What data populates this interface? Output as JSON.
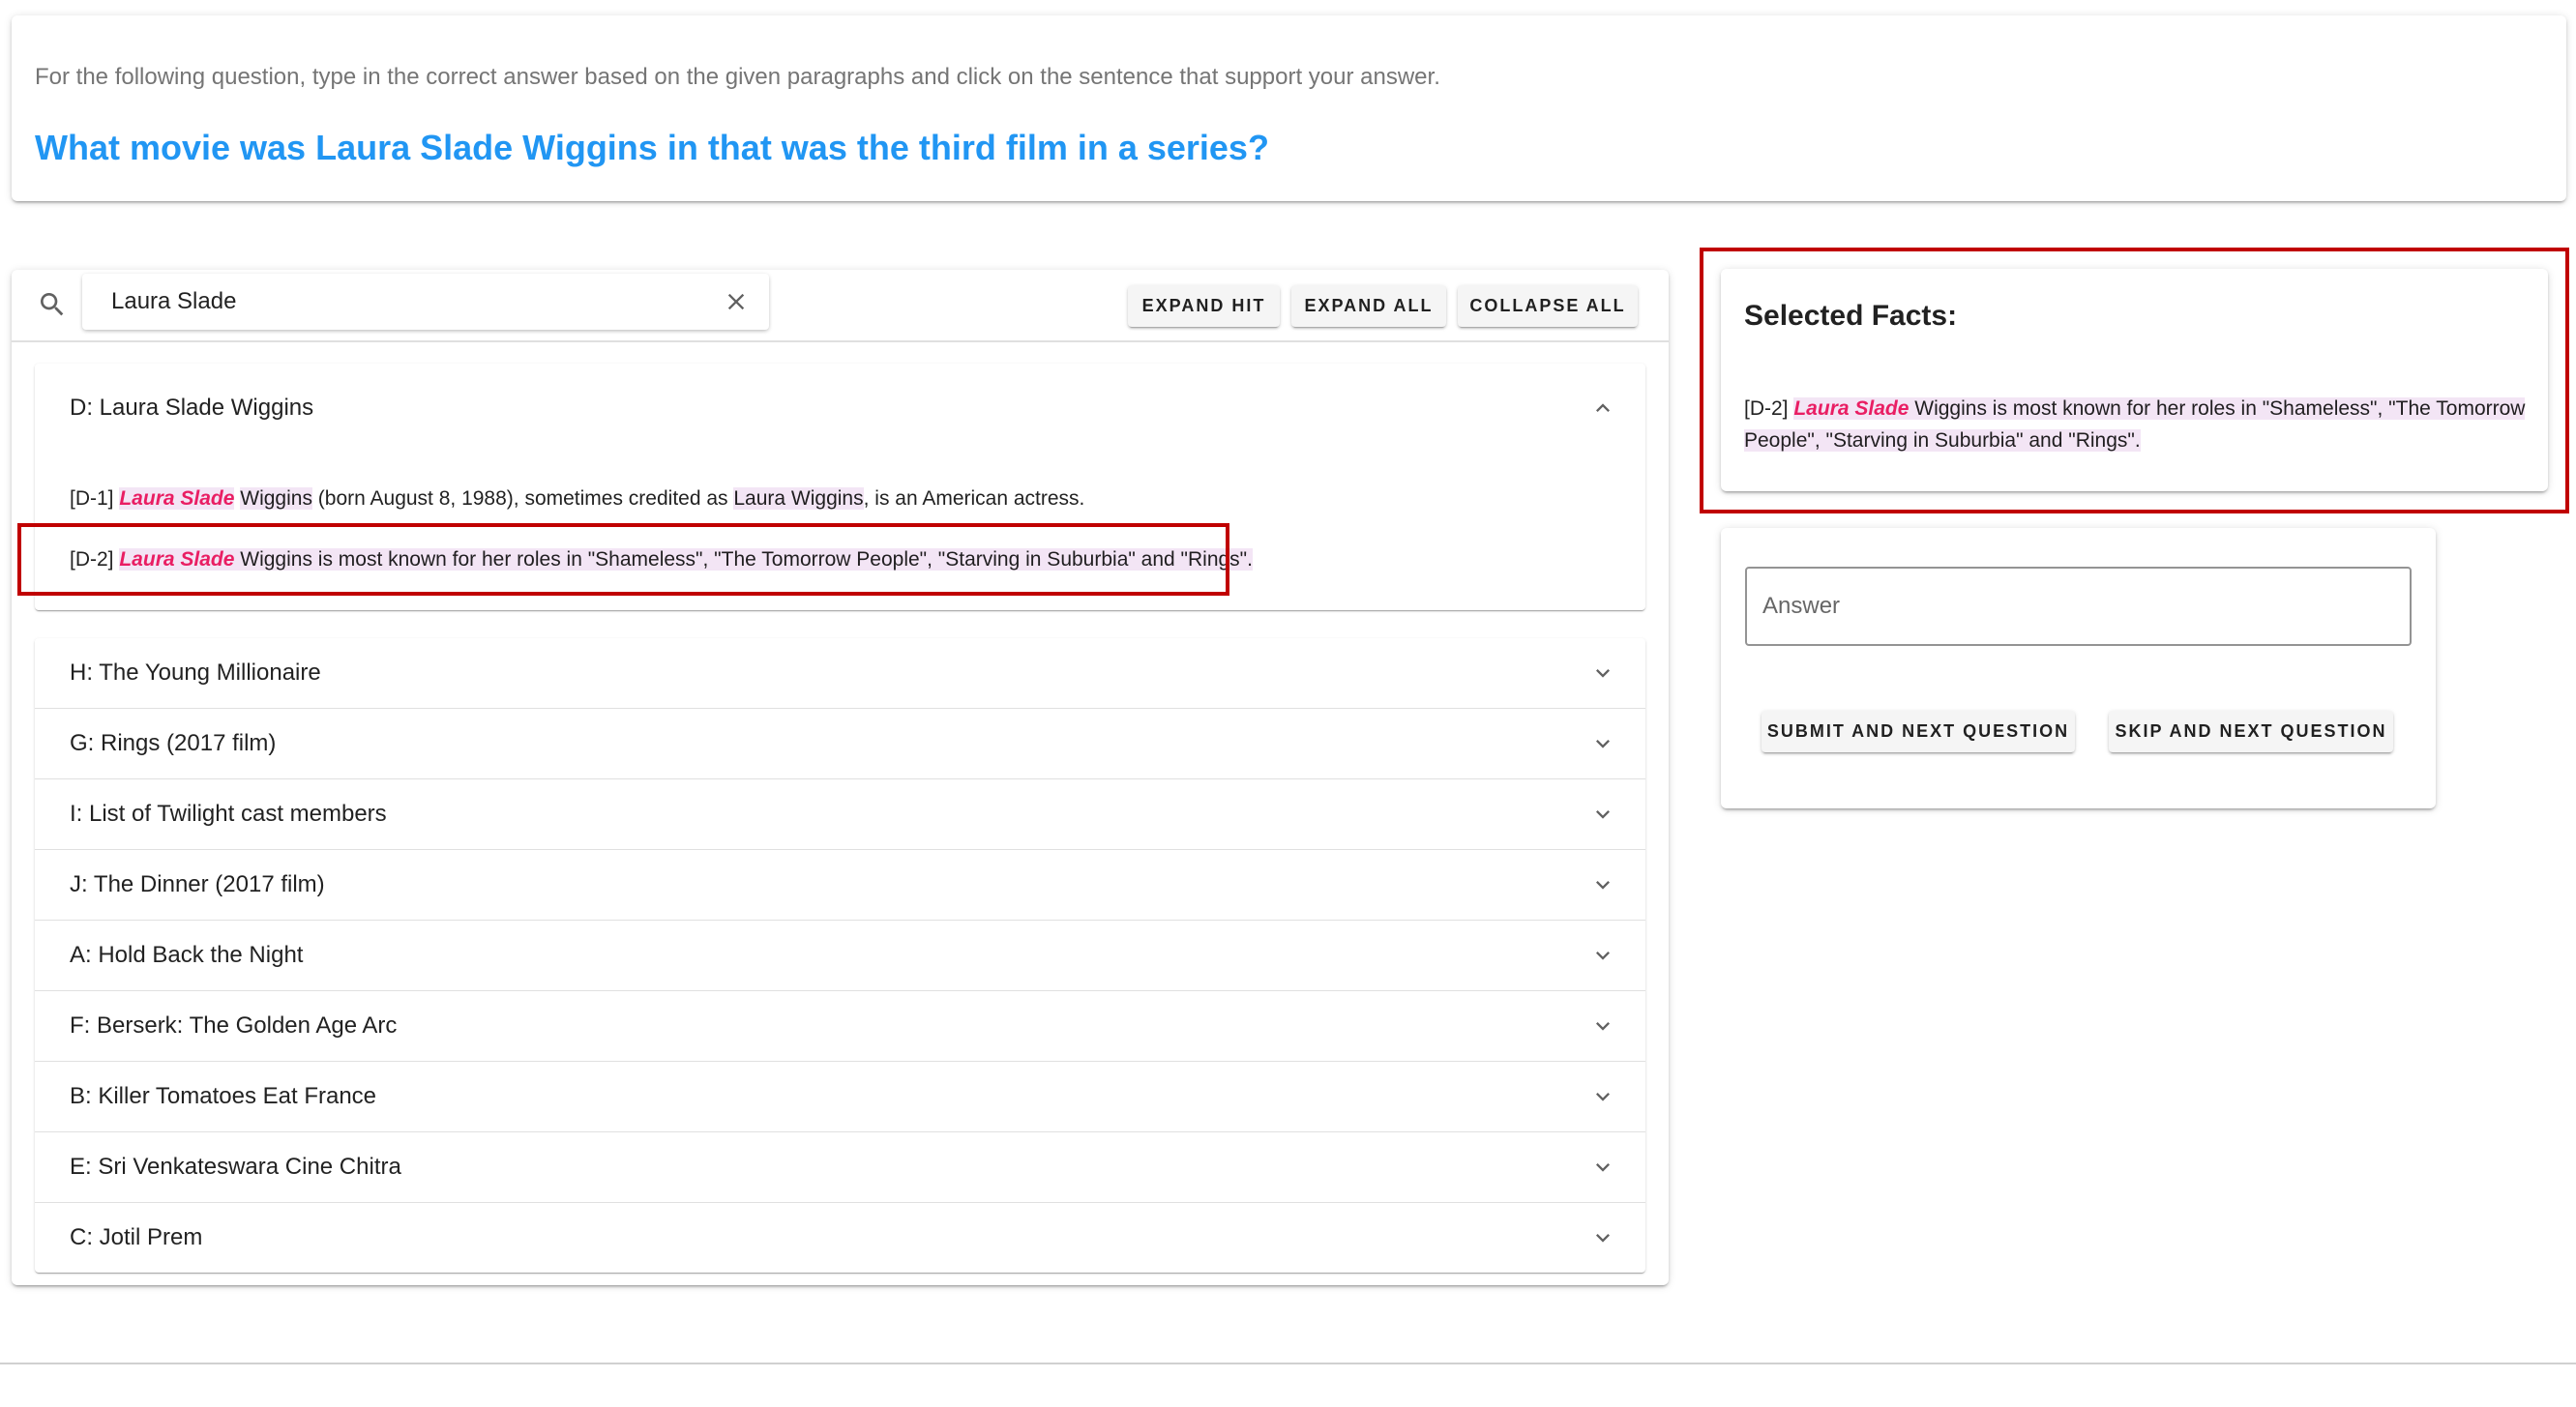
{
  "header": {
    "instruction": "For the following question, type in the correct answer based on the given paragraphs and click on the sentence that support your answer.",
    "question": "What movie was Laura Slade Wiggins in that was the third film in a series?"
  },
  "toolbar": {
    "search_value": "Laura Slade",
    "search_icon": "search-icon",
    "clear_icon": "close-icon",
    "expand_hit_label": "EXPAND HIT",
    "expand_all_label": "EXPAND ALL",
    "collapse_all_label": "COLLAPSE ALL"
  },
  "expanded_doc": {
    "title": "D: Laura Slade Wiggins",
    "sentences": [
      {
        "id": "[D-1]",
        "hit": "Laura Slade",
        "mid1": "Wiggins",
        "mid2": " (born August 8, 1988), sometimes credited as ",
        "hl2": "Laura Wiggins",
        "rest": ", is an American actress."
      },
      {
        "id": "[D-2]",
        "hit": "Laura Slade",
        "rest": " Wiggins is most known for her roles in \"Shameless\", \"The Tomorrow People\", \"Starving in Suburbia\" and \"Rings\"."
      }
    ]
  },
  "documents": [
    {
      "title": "H: The Young Millionaire"
    },
    {
      "title": "G: Rings (2017 film)"
    },
    {
      "title": "I: List of Twilight cast members"
    },
    {
      "title": "J: The Dinner (2017 film)"
    },
    {
      "title": "A: Hold Back the Night"
    },
    {
      "title": "F: Berserk: The Golden Age Arc"
    },
    {
      "title": "B: Killer Tomatoes Eat France"
    },
    {
      "title": "E: Sri Venkateswara Cine Chitra"
    },
    {
      "title": "C: Jotil Prem"
    }
  ],
  "facts": {
    "title": "Selected Facts:",
    "items": [
      {
        "id": "[D-2]",
        "hit": "Laura Slade",
        "rest": " Wiggins is most known for her roles in \"Shameless\", \"The Tomorrow People\", \"Starving in Suburbia\" and \"Rings\"."
      }
    ]
  },
  "answer": {
    "placeholder": "Answer",
    "value": "",
    "submit_label": "SUBMIT AND NEXT QUESTION",
    "skip_label": "SKIP AND NEXT QUESTION"
  },
  "colors": {
    "question": "#2196f3",
    "highlight_text": "#e91e63",
    "highlight_bg": "#f3e5f5",
    "annotation_box": "#c00000"
  }
}
